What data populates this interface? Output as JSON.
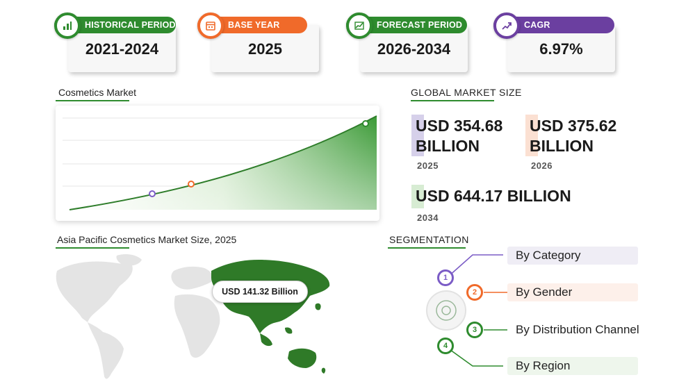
{
  "stats": [
    {
      "label": "HISTORICAL PERIOD",
      "value": "2021-2024",
      "color": "#2e8b2e",
      "icon": "bar-chart-icon"
    },
    {
      "label": "BASE YEAR",
      "value": "2025",
      "color": "#f06a2a",
      "icon": "calendar-icon"
    },
    {
      "label": "FORECAST PERIOD",
      "value": "2026-2034",
      "color": "#2e8b2e",
      "icon": "trend-chart-icon"
    },
    {
      "label": "CAGR",
      "value": "6.97%",
      "color": "#6b3fa0",
      "icon": "growth-icon"
    }
  ],
  "chart": {
    "title": "Cosmetics Market",
    "accent": "#2e8b2e",
    "marker_colors": [
      "#7b5cc6",
      "#f06a2a",
      "#2e8b2e"
    ]
  },
  "market_size": {
    "title": "GLOBAL MARKET SIZE",
    "entries": [
      {
        "amount_line1": "USD 354.68",
        "amount_line2": "BILLION",
        "year": "2025",
        "color": "#d6d0ea"
      },
      {
        "amount_line1": "USD 375.62",
        "amount_line2": "BILLION",
        "year": "2026",
        "color": "#fbe0d2"
      },
      {
        "amount": "USD 644.17 BILLION",
        "year": "2034",
        "color": "#d7ecd3"
      }
    ]
  },
  "region": {
    "title": "Asia Pacific Cosmetics Market Size, 2025",
    "value_label": "USD 141.32 Billion",
    "highlight_color": "#2f7a28"
  },
  "segmentation": {
    "title": "SEGMENTATION",
    "items": [
      {
        "num": "1",
        "label": "By Category",
        "color": "#7b5cc6",
        "bg": "#efedf5"
      },
      {
        "num": "2",
        "label": "By Gender",
        "color": "#f06a2a",
        "bg": "#fdf0ea"
      },
      {
        "num": "3",
        "label": "By Distribution Channel",
        "color": "#2e8b2e",
        "bg": "#ffffff"
      },
      {
        "num": "4",
        "label": "By Region",
        "color": "#2e8b2e",
        "bg": "#eef6ec"
      }
    ]
  }
}
